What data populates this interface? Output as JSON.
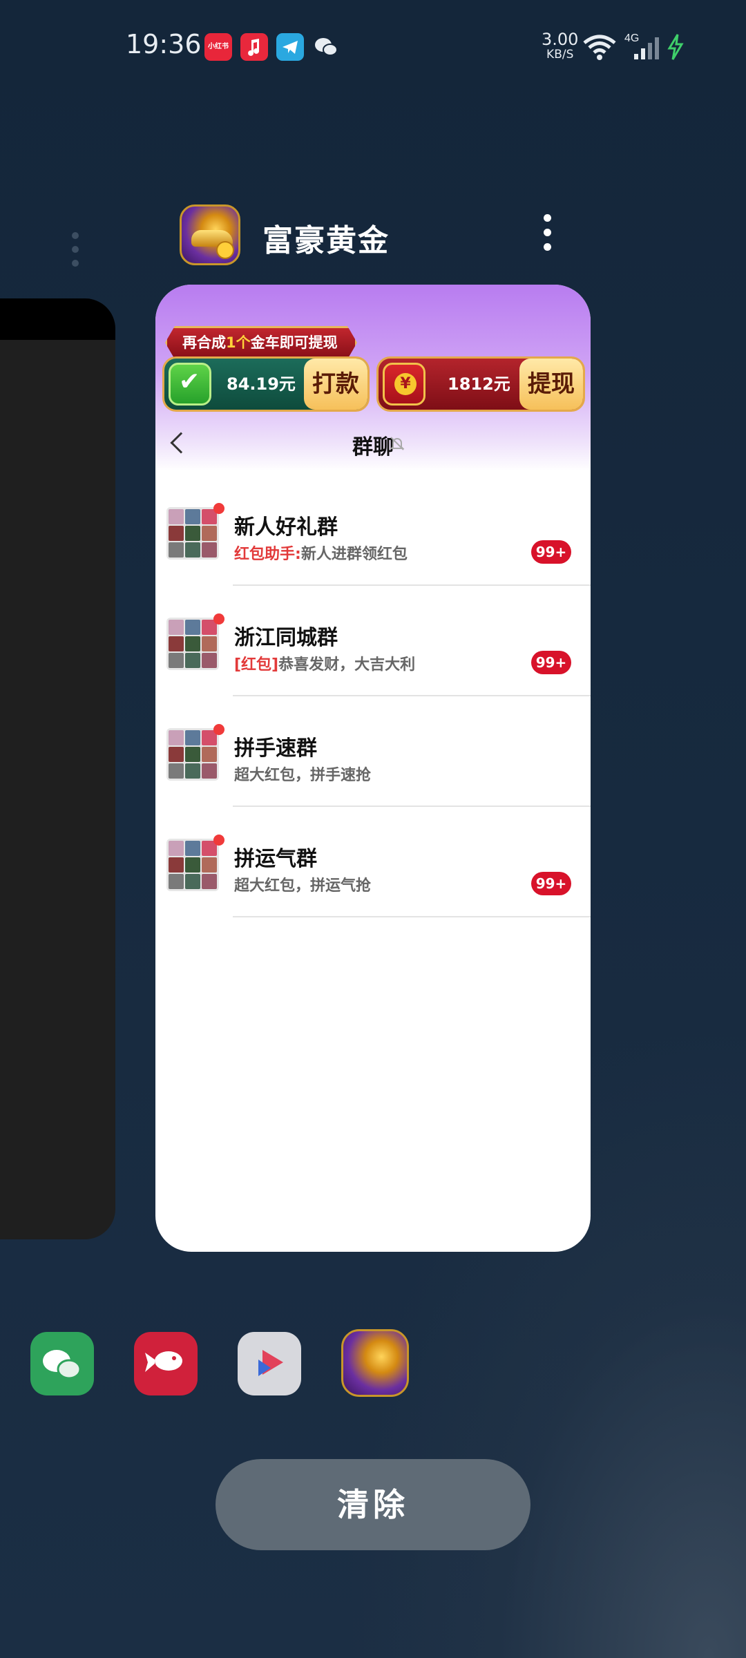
{
  "status_bar": {
    "time": "19:36",
    "net_speed_value": "3.00",
    "net_speed_unit": "KB/S",
    "network_type": "4G",
    "notification_icons": [
      "xiaohongshu-icon",
      "music-icon",
      "telegram-icon",
      "wechat-icon"
    ]
  },
  "recent_app": {
    "title": "富豪黄金",
    "icon": "gold-car-app-icon"
  },
  "app_screen": {
    "ribbon_prefix": "再合成",
    "ribbon_highlight": "1个",
    "ribbon_suffix": "金车即可提现",
    "wallet_amount": "84.19元",
    "wallet_action": "打款",
    "coin_amount": "1812元",
    "coin_action": "提现",
    "nav_title": "群聊",
    "chats": [
      {
        "name": "新人好礼群",
        "sender": "红包助手:",
        "message": "新人进群领红包",
        "badge": "99+"
      },
      {
        "name": "浙江同城群",
        "sender": "[红包]",
        "message": "恭喜发财，大吉大利",
        "badge": "99+"
      },
      {
        "name": "拼手速群",
        "sender": "",
        "message": "超大红包，拼手速抢",
        "badge": ""
      },
      {
        "name": "拼运气群",
        "sender": "",
        "message": "超大红包，拼运气抢",
        "badge": "99+"
      }
    ]
  },
  "dock": [
    "wechat-icon",
    "jd-icon",
    "video-player-icon",
    "gold-car-app-icon"
  ],
  "clear_button": "清除",
  "colors": {
    "badge_red": "#d8122a",
    "accent_purple": "#b87cf0",
    "clear_button_bg": "#5f6b76"
  }
}
